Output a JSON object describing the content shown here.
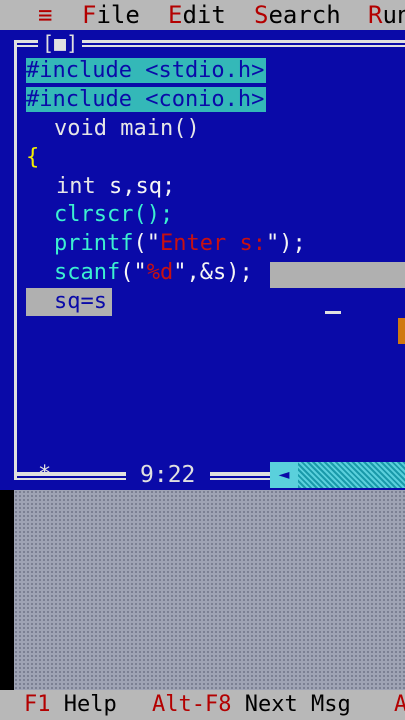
{
  "menu": {
    "system": "≡",
    "items": [
      {
        "hot": "F",
        "rest": "ile"
      },
      {
        "hot": "E",
        "rest": "dit"
      },
      {
        "hot": "S",
        "rest": "earch"
      },
      {
        "hot": "R",
        "rest": "un"
      }
    ]
  },
  "window": {
    "close_box": "[■]",
    "cursor_position": "9:22",
    "status_star": "*",
    "scroll_arrow": "◄"
  },
  "code": {
    "line1": "#include <stdio.h>",
    "line2": "#include <conio.h>",
    "line3": "void main()",
    "line4": "{",
    "line5_kw": "int",
    "line5_rest": " s,sq;",
    "line6": "clrscr();",
    "line7_fn": "printf",
    "line7_open": "(\"",
    "line7_str": "Enter s:",
    "line7_close": "\");",
    "line8_fn": "scanf",
    "line8_open": "(\"",
    "line8_str": "%d",
    "line8_close": "\",&s);",
    "line9": "sq=s"
  },
  "help": {
    "items": [
      {
        "key": "F1",
        "label": "Help"
      },
      {
        "key": "Alt-F8",
        "label": "Next Msg"
      },
      {
        "key": "A",
        "label": ""
      }
    ]
  },
  "colors": {
    "editor_bg": "#0a0aa8",
    "menu_bg": "#b8b8b8",
    "hotkey": "#b30000",
    "preprocessor_bg": "#34b8b8",
    "function": "#3cf0d0",
    "string": "#c81010"
  }
}
